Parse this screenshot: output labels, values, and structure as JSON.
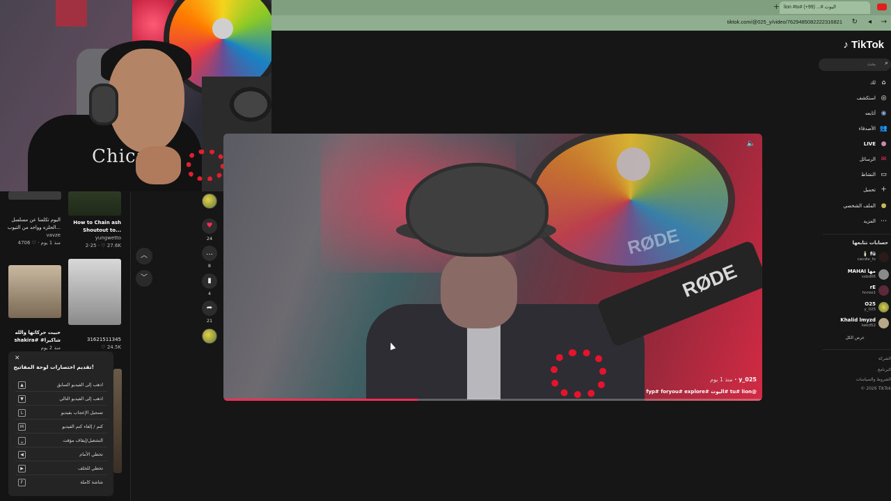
{
  "browser": {
    "tab_title": "lion #tu# اليوث #... (99+)",
    "url": "tiktok.com/@025_y/video/7629485082222316821"
  },
  "webcam": {
    "shirt_text": "Chica"
  },
  "feed": {
    "cards": [
      {
        "title": "اليوم تكلمنا عن مسلسل الحلزه وواحد من التيوب...",
        "author": "vavze",
        "views": "4706",
        "age": "منذ 1 يوم"
      },
      {
        "title": "How to Chain ash Shoutout to...",
        "author": "yungwetto",
        "views": "27.6K",
        "age": "2-25"
      },
      {
        "title": "حبيت حركاتها والله shakira# #شاكيرا",
        "author": "",
        "views": "",
        "age": "منذ 2 يوم"
      },
      {
        "title": "31621511345",
        "author": "",
        "views": "24.5K",
        "age": ""
      }
    ]
  },
  "shortcuts": {
    "title": "تقديم اختصارات لوحة المفاتيح!",
    "rows": [
      {
        "key": "▲",
        "label": "اذهب إلى الفيديو السابق"
      },
      {
        "key": "▼",
        "label": "اذهب إلى الفيديو التالي"
      },
      {
        "key": "L",
        "label": "تسجيل الإعجاب بفيديو"
      },
      {
        "key": "M",
        "label": "كتم / إلغاء كتم الفيديو"
      },
      {
        "key": "␣",
        "label": "التشغيل/إيقاف مؤقت"
      },
      {
        "key": "◀",
        "label": "تخطي الأمام"
      },
      {
        "key": "▶",
        "label": "تخطي للخلف"
      },
      {
        "key": "F",
        "label": "شاشة كاملة"
      }
    ]
  },
  "actions": {
    "likes": "24",
    "comments": "8",
    "saves": "4",
    "shares": "21"
  },
  "video": {
    "username": "y_025",
    "ago": "منذ 1 يوم",
    "caption": "fyp# foryou# explore# اليوث# tu# lion@",
    "progress": 0.36
  },
  "sidebar": {
    "logo": "TikTok",
    "search_placeholder": "بحث",
    "nav": [
      {
        "label": "لك",
        "icon": "⌂"
      },
      {
        "label": "استكشف",
        "icon": "◎"
      },
      {
        "label": "أتابعه",
        "icon": "◉"
      },
      {
        "label": "الأصدقاء",
        "icon": "👥"
      },
      {
        "label": "LIVE",
        "icon": "●"
      },
      {
        "label": "الرسائل",
        "icon": "✉"
      },
      {
        "label": "النشاط",
        "icon": "▭"
      },
      {
        "label": "تحميل",
        "icon": "＋"
      },
      {
        "label": "الملف الشخصي",
        "icon": "●"
      },
      {
        "label": "المزيد",
        "icon": "⋯"
      }
    ],
    "following_title": "حسابات تتابعها",
    "following": [
      {
        "name": "🕯️ fü",
        "handle": "candle_fo"
      },
      {
        "name": "MAHAI مها",
        "handle": "sxbd06"
      },
      {
        "name": "rE",
        "handle": "hnroo1"
      },
      {
        "name": "O25",
        "handle": "y_025"
      },
      {
        "name": "Khalid lmyzd",
        "handle": "kekd52"
      }
    ],
    "see_all": "عرض الكل",
    "footer": [
      "الشركة",
      "البرنامج",
      "الشروط والسياسات",
      "© 2026 TikTok"
    ]
  }
}
